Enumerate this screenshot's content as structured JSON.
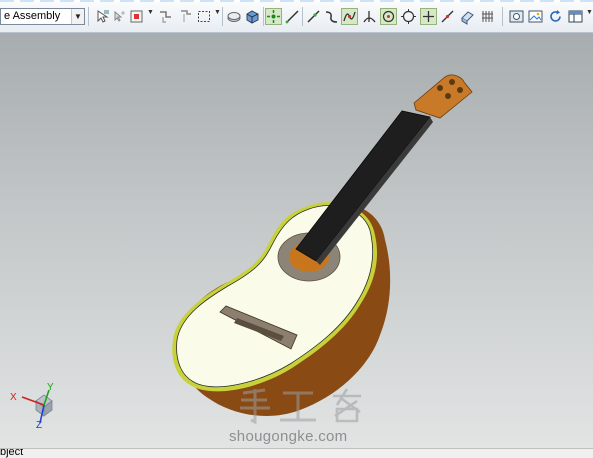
{
  "toolbar": {
    "selection_filter": "e Assembly",
    "icons": [
      "selection-icon",
      "select-all-icon",
      "snap-icon",
      "drag-icon",
      "box-select-icon",
      "part-icon",
      "solid-icon",
      "snap-point-icon",
      "line-icon",
      "tangent-line-icon",
      "curve-icon",
      "inflection-icon",
      "perpendicular-icon",
      "center-point-icon",
      "circle-icon",
      "cross-icon",
      "line-point-icon",
      "component-icon",
      "grid-icon",
      "view-icon",
      "image-icon",
      "refresh-icon",
      "layout-icon"
    ]
  },
  "viewport": {
    "triad_labels": {
      "x": "X",
      "y": "Y",
      "z": "Z"
    },
    "watermark_text": "shougongke.com",
    "watermark_logo": "手工客",
    "colors": {
      "body_top": "#fbfbe9",
      "body_side": "#8a4a14",
      "neck": "#1e1e1e",
      "head": "#c87a28",
      "binding": "#c7d13a"
    }
  },
  "statusbar": {
    "text": "bject"
  }
}
